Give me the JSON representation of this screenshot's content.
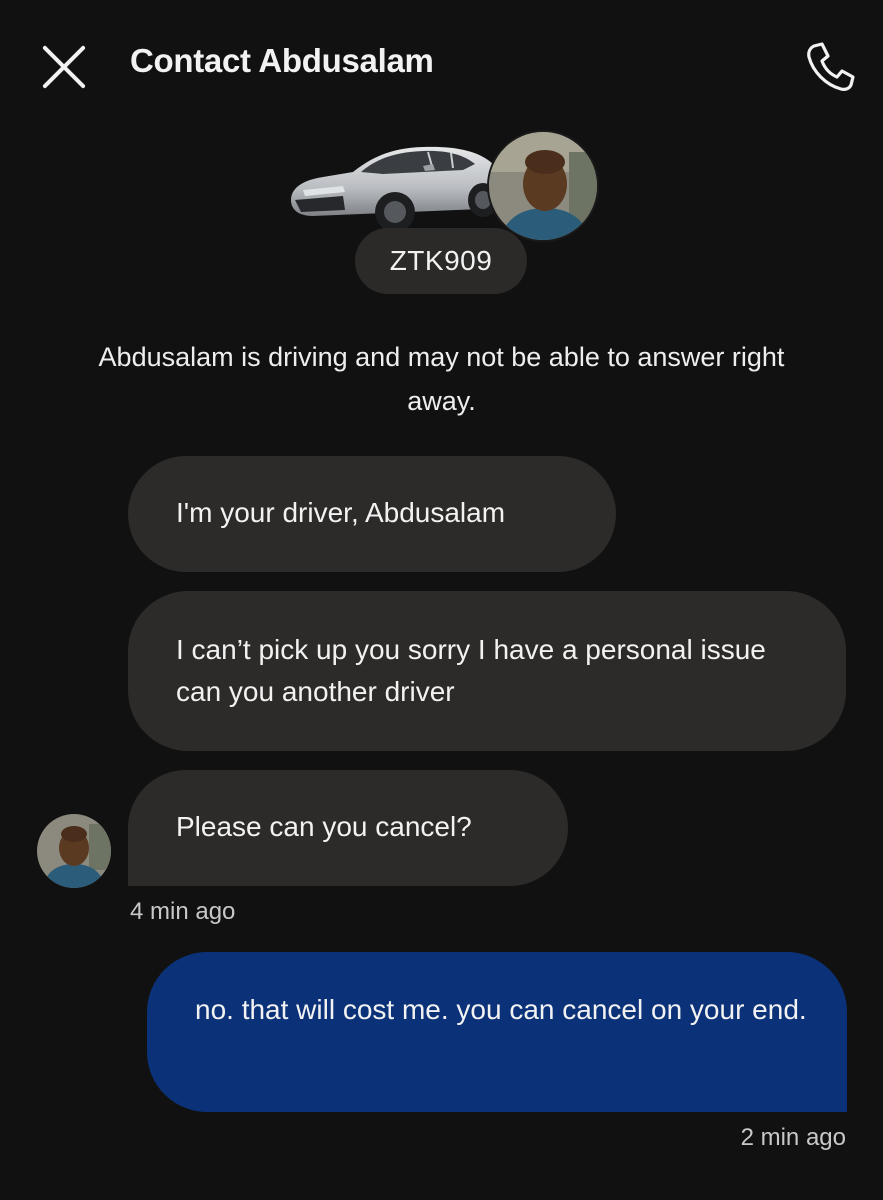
{
  "header": {
    "title": "Contact Abdusalam",
    "close_icon": "close-icon",
    "call_icon": "phone-icon"
  },
  "vehicle": {
    "plate": "ZTK909",
    "car_color": "silver"
  },
  "notice": "Abdusalam is driving and may not be able to answer right away.",
  "messages": [
    {
      "sender": "driver",
      "text": "I'm your driver, Abdusalam"
    },
    {
      "sender": "driver",
      "text": "I can’t pick up you sorry I have a personal issue can you another driver"
    },
    {
      "sender": "driver",
      "text": "Please can you cancel?",
      "time": "4 min ago"
    },
    {
      "sender": "me",
      "text": "no. that will cost me. you can cancel on your end.",
      "time": "2 min ago"
    }
  ],
  "colors": {
    "background": "#111111",
    "incoming_bubble": "#2d2b29",
    "outgoing_bubble": "#0b3278",
    "text": "#f2f2f2",
    "timestamp": "#c8c8c8"
  }
}
